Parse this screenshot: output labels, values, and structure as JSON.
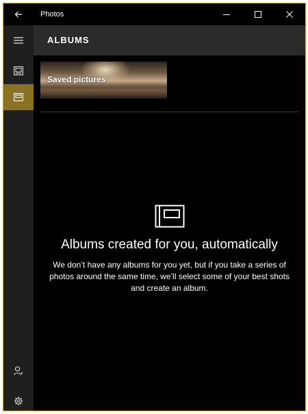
{
  "window": {
    "title": "Photos",
    "accent_color": "#8a7224",
    "border_color": "#c9a33c",
    "controls": {
      "back_icon": "arrow-left-icon",
      "minimize_icon": "minimize-icon",
      "maximize_icon": "maximize-icon",
      "close_icon": "close-icon"
    }
  },
  "nav": {
    "items": [
      {
        "icon": "hamburger-icon",
        "active": false
      },
      {
        "icon": "collection-icon",
        "active": false
      },
      {
        "icon": "albums-icon",
        "active": true
      },
      {
        "icon": "people-icon",
        "active": false
      },
      {
        "icon": "settings-gear-icon",
        "active": false
      }
    ]
  },
  "header": {
    "title": "ALBUMS"
  },
  "albums": [
    {
      "label": "Saved pictures"
    }
  ],
  "empty_state": {
    "icon": "album-frame-icon",
    "heading": "Albums created for you, automatically",
    "body": "We don’t have any albums for you yet, but if you take a series of photos around the same time, we’ll select some of your best shots and create an album."
  }
}
